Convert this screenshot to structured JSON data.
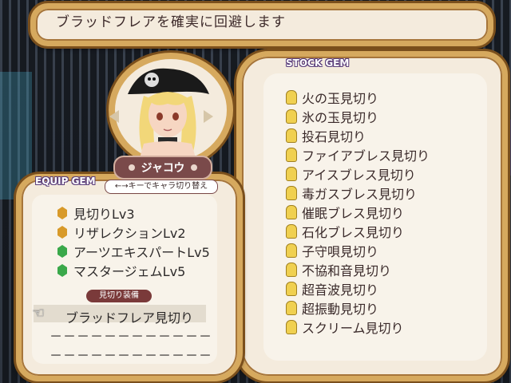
{
  "message": "ブラッドフレアを確実に回避します",
  "character": {
    "name": "ジャコウ",
    "switch_hint": "←→キーでキャラ切り替え"
  },
  "equip": {
    "title": "EQUIP GEM",
    "gems": [
      {
        "label": "見切りLv3",
        "icon": "gem-orange-icon"
      },
      {
        "label": "リザレクションLv2",
        "icon": "gem-orange-icon"
      },
      {
        "label": "アーツエキスパートLv5",
        "icon": "gem-green-icon"
      },
      {
        "label": "マスタージェムLv5",
        "icon": "gem-green-icon"
      }
    ],
    "slot_label": "見切り装備",
    "selected": "ブラッドフレア見切り",
    "empty_slots": [
      "－－－－－－－－－－－－",
      "－－－－－－－－－－－－"
    ]
  },
  "stock": {
    "title": "STOCK GEM",
    "gems": [
      "火の玉見切り",
      "氷の玉見切り",
      "投石見切り",
      "ファイアブレス見切り",
      "アイスブレス見切り",
      "毒ガスブレス見切り",
      "催眠ブレス見切り",
      "石化ブレス見切り",
      "子守唄見切り",
      "不協和音見切り",
      "超音波見切り",
      "超振動見切り",
      "スクリーム見切り"
    ]
  },
  "colors": {
    "frame_gold": "#d6a95e",
    "panel_bg": "#f4ebdd",
    "title_outline": "#5a3d7a",
    "nameplate": "#7a4a4a",
    "gem_orange": "#d89a2a",
    "gem_green": "#3aa84a",
    "bulb_yellow": "#f0d050"
  }
}
